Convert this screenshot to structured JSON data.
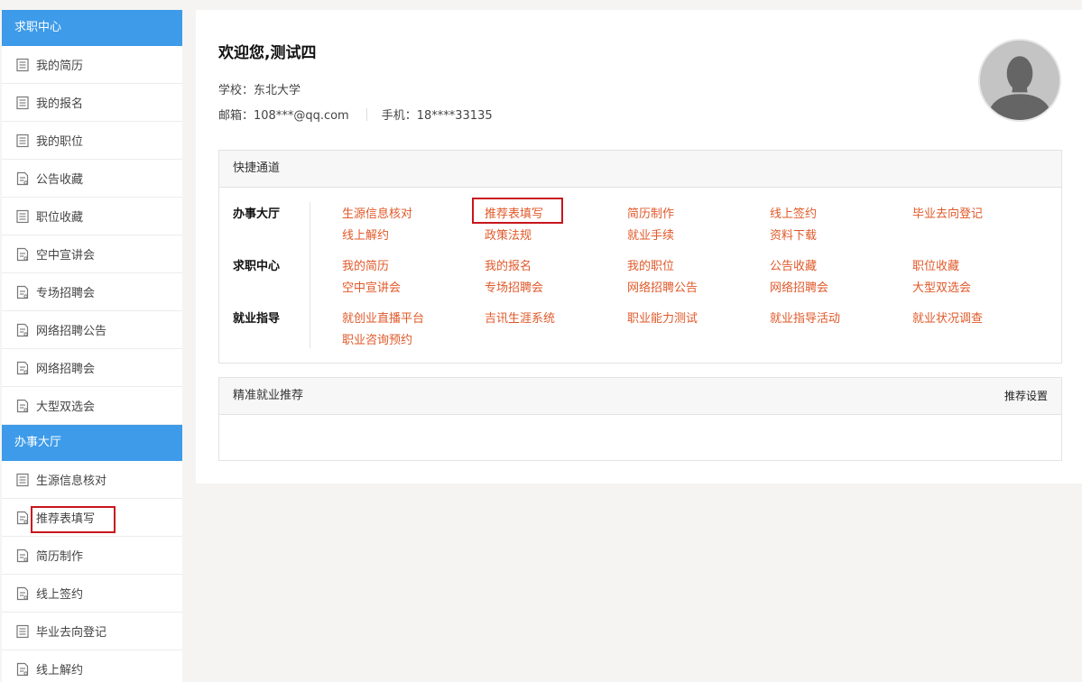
{
  "sidebar": {
    "group1": {
      "title": "求职中心",
      "items": [
        "我的简历",
        "我的报名",
        "我的职位",
        "公告收藏",
        "职位收藏",
        "空中宣讲会",
        "专场招聘会",
        "网络招聘公告",
        "网络招聘会",
        "大型双选会"
      ]
    },
    "group2": {
      "title": "办事大厅",
      "items": [
        "生源信息核对",
        "推荐表填写",
        "简历制作",
        "线上签约",
        "毕业去向登记",
        "线上解约"
      ]
    }
  },
  "main": {
    "welcome": "欢迎您,测试四",
    "school": "学校：东北大学",
    "email": "邮箱：108***@qq.com",
    "phone": "手机：18****33135"
  },
  "quick": {
    "title": "快捷通道",
    "sections": [
      {
        "label": "办事大厅",
        "links": [
          "生源信息核对",
          "推荐表填写",
          "简历制作",
          "线上签约",
          "毕业去向登记",
          "线上解约",
          "政策法规",
          "就业手续",
          "资料下载"
        ]
      },
      {
        "label": "求职中心",
        "links": [
          "我的简历",
          "我的报名",
          "我的职位",
          "公告收藏",
          "职位收藏",
          "空中宣讲会",
          "专场招聘会",
          "网络招聘公告",
          "网络招聘会",
          "大型双选会"
        ]
      },
      {
        "label": "就业指导",
        "links": [
          "就创业直播平台",
          "吉讯生涯系统",
          "职业能力测试",
          "就业指导活动",
          "就业状况调查",
          "职业咨询预约"
        ]
      }
    ]
  },
  "recommend": {
    "title": "精准就业推荐",
    "settings": "推荐设置"
  },
  "colors": {
    "accent": "#3d9be9",
    "link": "#e0592a",
    "highlight": "#c8161d"
  }
}
